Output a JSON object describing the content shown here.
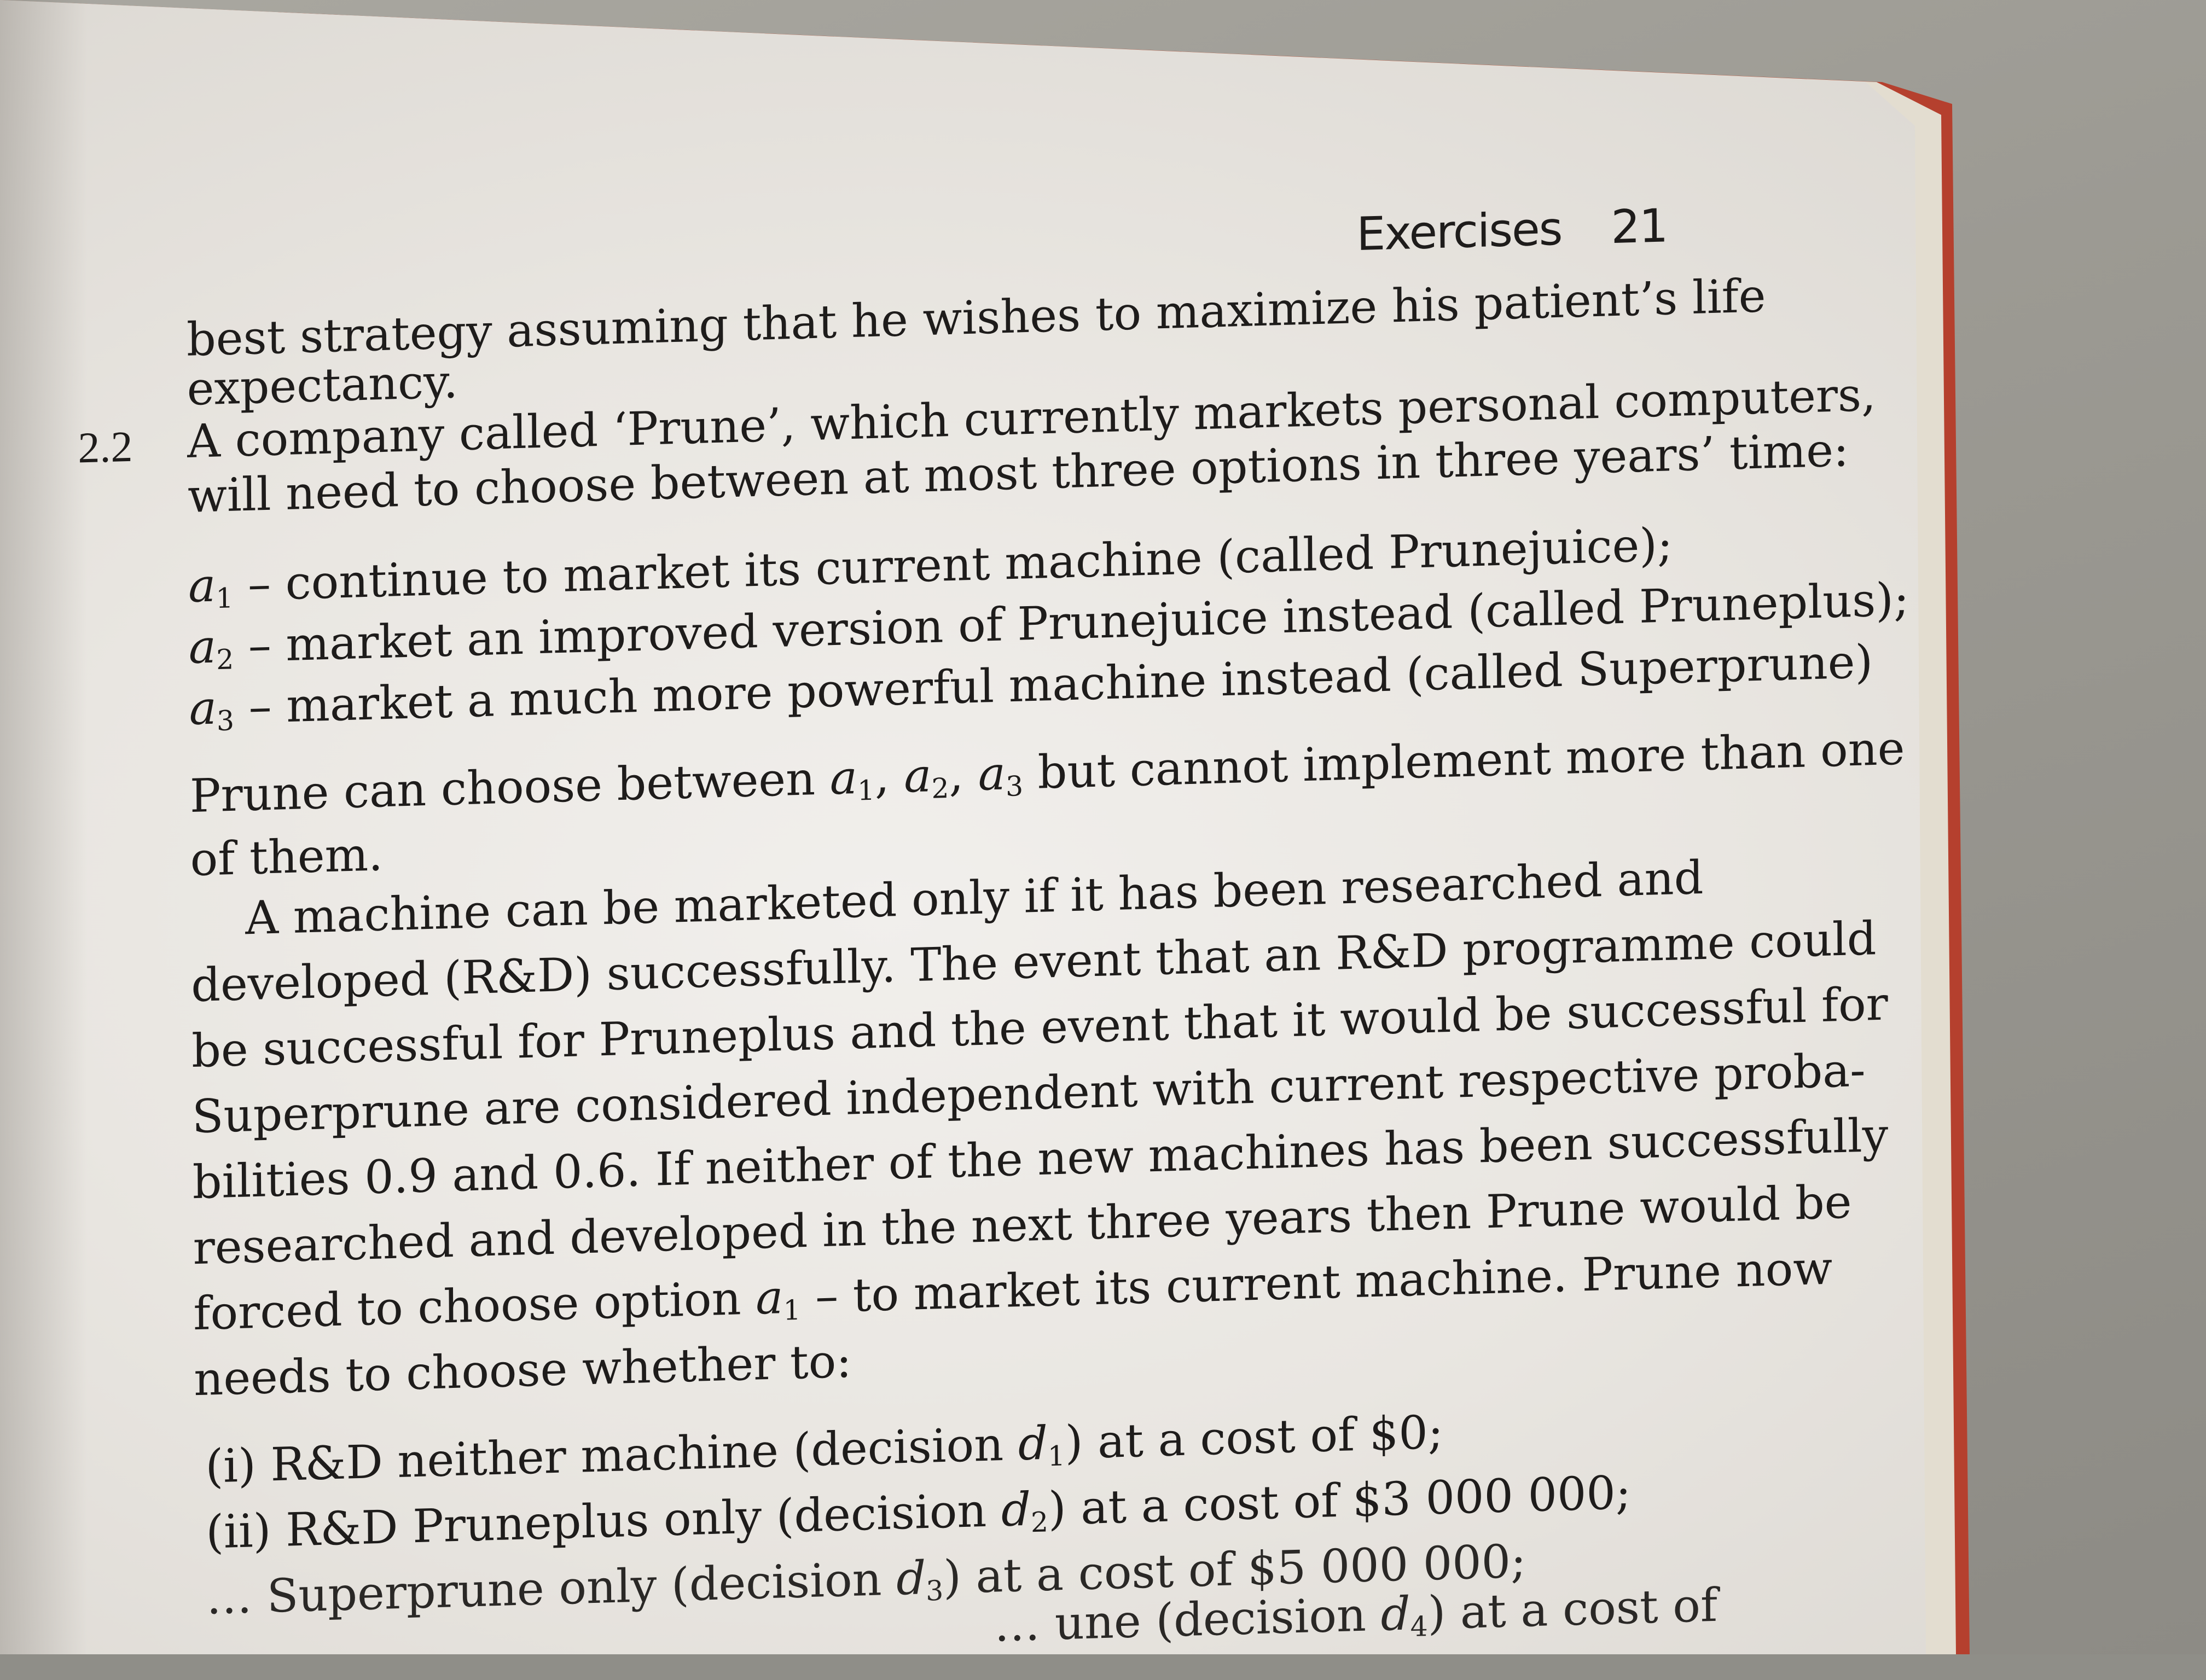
{
  "running_head": {
    "title": "Exercises",
    "page_number": "21"
  },
  "continuation": {
    "line1": "best strategy assuming that he wishes to maximize his patient’s life",
    "line2": "expectancy."
  },
  "exercise": {
    "number": "2.2",
    "intro_line1": "A company called ‘Prune’, which currently markets personal computers,",
    "intro_line2": "will need to choose between at most three options in three years’ time:",
    "options": [
      {
        "symbol": "a",
        "sub": "1",
        "text": " – continue to market its current machine (called Prunejuice);"
      },
      {
        "symbol": "a",
        "sub": "2",
        "text": " – market an improved version of Prunejuice instead (called Pruneplus);"
      },
      {
        "symbol": "a",
        "sub": "3",
        "text": " – market a much more powerful machine instead (called Superprune)"
      }
    ],
    "choose_line1_pre": "Prune can choose between ",
    "choose_line1_post": " but cannot implement more than one",
    "choose_line2": "of them.",
    "para_lines": [
      "A machine can be marketed only if it has been researched and",
      "developed (R&D) successfully. The event that an R&D programme could",
      "be successful for Pruneplus and the event that it would be successful for",
      "Superprune are considered independent with current respective proba-",
      "bilities 0.9 and 0.6. If neither of the new machines has been successfully",
      "researched and developed in the next three years then Prune would be"
    ],
    "forced_pre": "forced to choose option ",
    "forced_post": " – to market its current machine. Prune now",
    "needs_line": "needs to choose whether to:",
    "decisions": [
      {
        "label": "(i) R&D neither machine (decision ",
        "sub": "1",
        "cost": ") at a cost of $0;"
      },
      {
        "label": "(ii) R&D Pruneplus only (decision ",
        "sub": "2",
        "cost": ") at a cost of $3 000 000;"
      },
      {
        "label": "… Superprune only (decision ",
        "sub": "3",
        "cost": ") at a cost of $5 000 000;"
      },
      {
        "label": "… une (decision ",
        "sub": "4",
        "cost": ") at a cost of"
      }
    ]
  }
}
